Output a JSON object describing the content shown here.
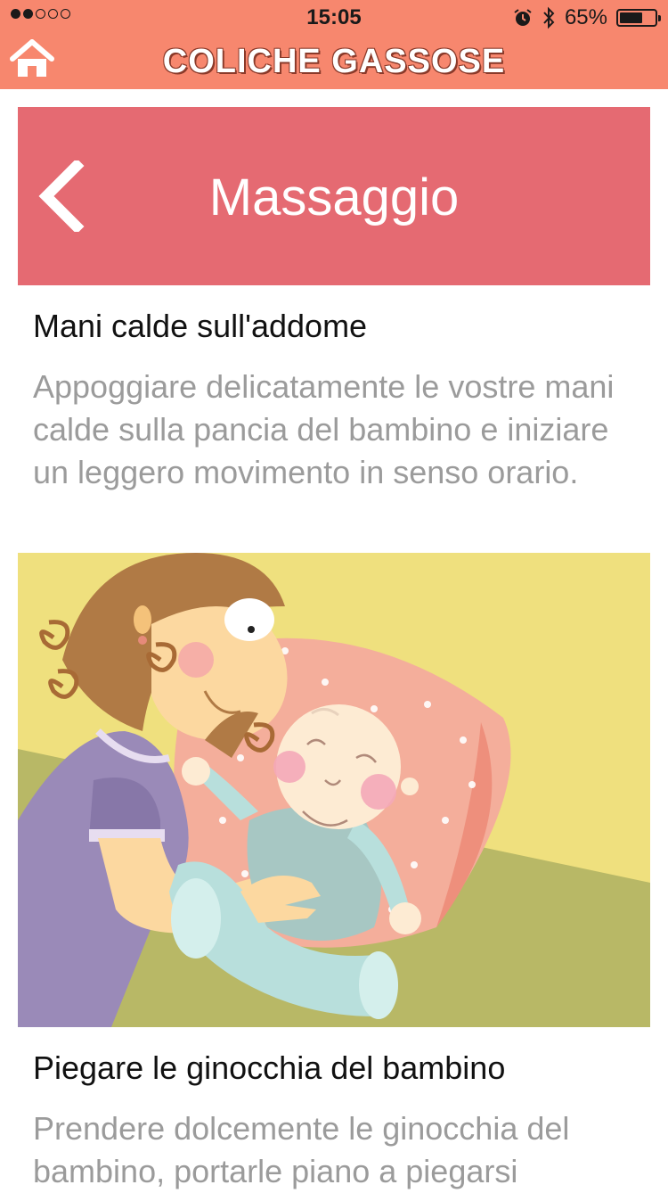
{
  "status": {
    "time": "15:05",
    "battery": "65%",
    "battery_level": 0.65,
    "icons": [
      "alarm-icon",
      "bluetooth-icon",
      "battery-icon"
    ]
  },
  "header": {
    "title": "COLICHE GASSOSE",
    "home_icon": "home-icon"
  },
  "section": {
    "title": "Massaggio",
    "back_icon": "chevron-left-icon"
  },
  "steps": [
    {
      "title": "Mani calde sull'addome",
      "description": "Appoggiare delicatamente le vostre mani calde sulla pancia del bambino e iniziare un leggero movimento in senso orario."
    },
    {
      "title": "Piegare le ginocchia del bambino",
      "description": "Prendere dolcemente le ginocchia del bambino, portarle piano a piegarsi"
    }
  ],
  "colors": {
    "header": "#f7876e",
    "banner": "#e56a72",
    "title_text": "#111111",
    "desc_text": "#9b9b9b"
  }
}
